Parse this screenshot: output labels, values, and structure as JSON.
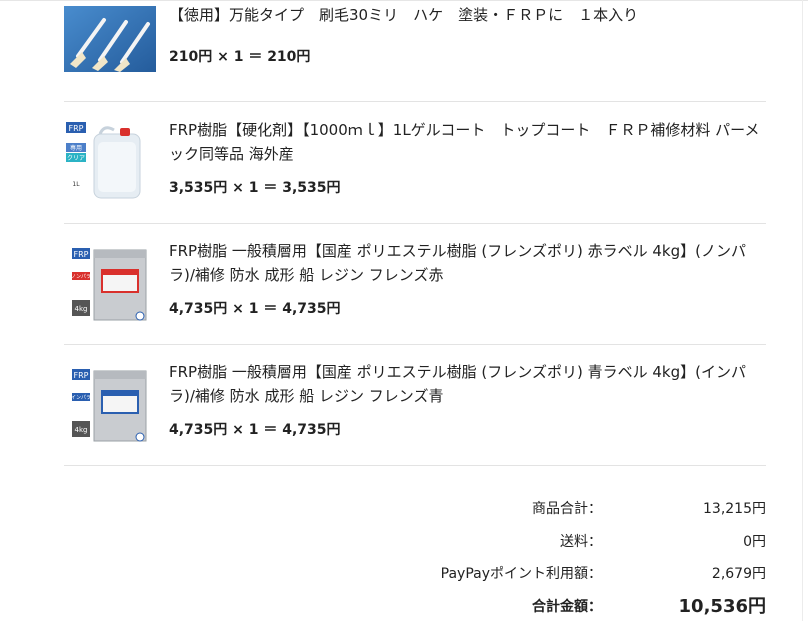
{
  "items": [
    {
      "title": "【徳用】万能タイプ　刷毛30ミリ　ハケ　塗装・ＦＲＰに　１本入り",
      "price_line": "210円 × 1 ＝ 210円"
    },
    {
      "title": "FRP樹脂【硬化剤】【1000ｍｌ】1Lゲルコート　トップコート　ＦＲＰ補修材料 パーメック同等品 海外産",
      "price_line": "3,535円 × 1 ＝ 3,535円",
      "thumb_labels": [
        "FRP",
        "専用",
        "クリア",
        "1L"
      ]
    },
    {
      "title": "FRP樹脂 一般積層用【国産 ポリエステル樹脂 (フレンズポリ) 赤ラベル 4kg】(ノンパラ)/補修 防水 成形 船 レジン フレンズ赤",
      "price_line": "4,735円 × 1 ＝ 4,735円",
      "thumb_labels": [
        "FRP",
        "ノンパラ",
        "4kg"
      ]
    },
    {
      "title": "FRP樹脂 一般積層用【国産 ポリエステル樹脂 (フレンズポリ) 青ラベル 4kg】(インパラ)/補修 防水 成形 船 レジン フレンズ青",
      "price_line": "4,735円 × 1 ＝ 4,735円",
      "thumb_labels": [
        "FRP",
        "インパラ",
        "4kg"
      ]
    }
  ],
  "summary": {
    "subtotal_label": "商品合計：",
    "subtotal_value": "13,215円",
    "shipping_label": "送料：",
    "shipping_value": "0円",
    "points_label": "PayPayポイント利用額：",
    "points_value": "2,679円",
    "total_label": "合計金額：",
    "total_value": "10,536円"
  },
  "colors": {
    "text": "#222222",
    "divider": "#e3e3e3",
    "brush_bg": "#2f6fb3",
    "label_red": "#d9302c",
    "label_blue": "#2a5fb0"
  }
}
